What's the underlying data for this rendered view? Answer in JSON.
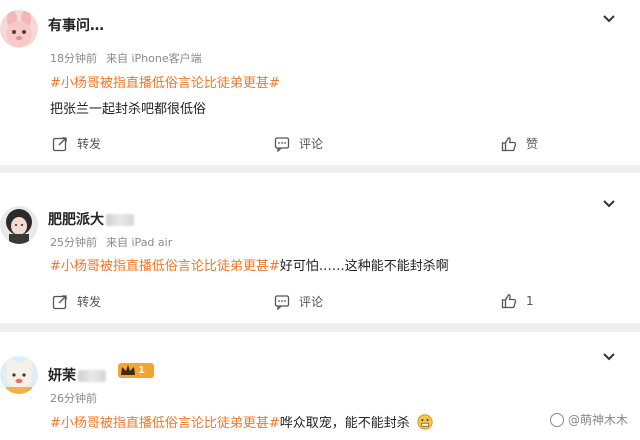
{
  "comments": [
    {
      "username": "有事问…",
      "time": "18分钟前",
      "source": "来自 iPhone客户端",
      "hashtag": "#小杨哥被指直播低俗言论比徒弟更甚#",
      "text": "把张兰一起封杀吧都很低俗",
      "repost_label": "转发",
      "comment_label": "评论",
      "like_label": "赞"
    },
    {
      "username": "肥肥派大",
      "time": "25分钟前",
      "source": "来自 iPad air",
      "hashtag": "#小杨哥被指直播低俗言论比徒弟更甚#",
      "text": "好可怕……这种能不能封杀啊",
      "repost_label": "转发",
      "comment_label": "评论",
      "like_count": "1"
    },
    {
      "username": "妍茉",
      "badge_level": "1",
      "time": "26分钟前",
      "hashtag": "#小杨哥被指直播低俗言论比徒弟更甚#",
      "text": "哗众取宠，能不能封杀"
    }
  ],
  "watermark": "@萌神木木",
  "icons": {
    "chevron": "chevron-down-icon",
    "repost": "repost-icon",
    "comment": "comment-icon",
    "like": "thumbs-up-icon",
    "emoji": "grimace-emoji-icon"
  },
  "colors": {
    "hashtag": "#f07a2a",
    "badge": "#f3a530",
    "background": "#eef0f2"
  }
}
